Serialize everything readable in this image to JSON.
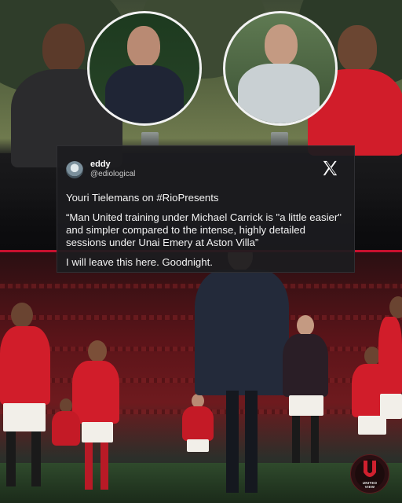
{
  "tweet": {
    "name": "eddy",
    "handle": "@ediological",
    "line1": "Youri Tielemans on #RioPresents",
    "quote": "“Man United training under Michael Carrick is \"a little easier\" and simpler compared to the intense, highly detailed sessions under Unai Emery at Aston Villa”",
    "line3": "I will leave this here. Goodnight.",
    "icon": "x-logo-icon"
  },
  "logo": {
    "line1": "UNITED",
    "line2": "VIEW"
  },
  "colors": {
    "accent_red": "#c8102e",
    "card_bg": "#1c1c1f"
  }
}
